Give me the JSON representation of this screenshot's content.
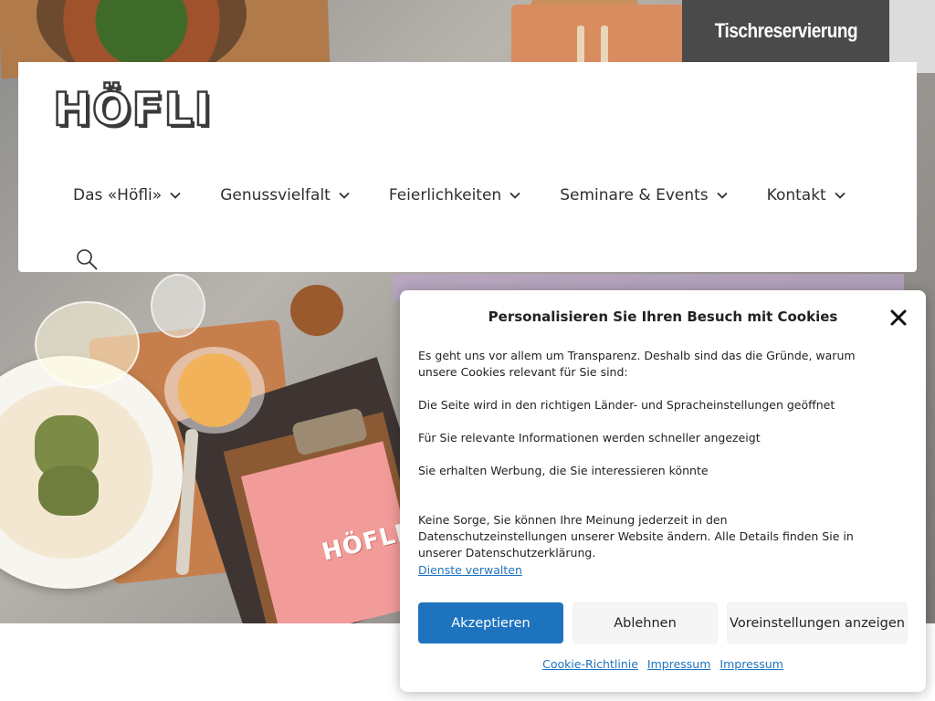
{
  "reservation": {
    "label": "Tischreservierung"
  },
  "header": {
    "logo_text": "HÖFLI",
    "nav": [
      {
        "label": "Das «Höfli»"
      },
      {
        "label": "Genussvielfalt"
      },
      {
        "label": "Feierlichkeiten"
      },
      {
        "label": "Seminare & Events"
      },
      {
        "label": "Kontakt"
      }
    ],
    "search_icon": "search-icon"
  },
  "hero": {
    "menu_card_text": "HÖFLI"
  },
  "cookie": {
    "title": "Personalisieren Sie Ihren Besuch mit Cookies",
    "intro": "Es geht uns vor allem um Transparenz. Deshalb sind das die Gründe, warum unsere Cookies relevant für Sie sind:",
    "reasons": [
      "Die Seite wird in den richtigen Länder- und Spracheinstellungen geöffnet",
      "Für Sie relevante Informationen werden schneller angezeigt",
      "Sie erhalten Werbung, die Sie interessieren könnte"
    ],
    "note": "Keine Sorge, Sie können Ihre Meinung jederzeit in den Datenschutzeinstellungen unserer Website ändern. Alle Details finden Sie in unserer Datenschutzerklärung.",
    "manage_link": "Dienste verwalten",
    "buttons": {
      "accept": "Akzeptieren",
      "deny": "Ablehnen",
      "preferences": "Voreinstellungen anzeigen"
    },
    "footer_links": [
      "Cookie-Richtlinie",
      "Impressum",
      "Impressum"
    ]
  },
  "colors": {
    "accent": "#1e73be",
    "reservation_bg": "#4a4a4a",
    "text": "#2e2e2e"
  }
}
